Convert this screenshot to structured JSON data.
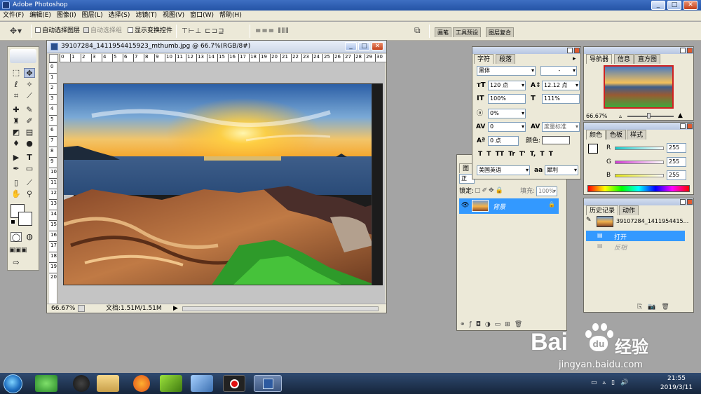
{
  "app": {
    "title": "Adobe Photoshop",
    "window_buttons": [
      "_",
      "□",
      "✕"
    ]
  },
  "menu": [
    "文件(F)",
    "编辑(E)",
    "图像(I)",
    "图层(L)",
    "选择(S)",
    "滤镜(T)",
    "视图(V)",
    "窗口(W)",
    "帮助(H)"
  ],
  "options": {
    "auto_select_layer": "自动选择图层",
    "auto_select_group": "自动选择组",
    "show_transform": "显示变换控件",
    "palette_tabs": [
      "画笔",
      "工具预设",
      "图层复合"
    ]
  },
  "document": {
    "title": "39107284_1411954415923_mthumb.jpg @ 66.7%(RGB/8#)",
    "zoom": "66.67%",
    "file_info": "文档:1.51M/1.51M",
    "ruler_h": [
      "0",
      "1",
      "2",
      "3",
      "4",
      "5",
      "6",
      "7",
      "8",
      "9",
      "10",
      "11",
      "12",
      "13",
      "14",
      "15",
      "16",
      "17",
      "18",
      "19",
      "20",
      "21",
      "22",
      "23",
      "24",
      "25",
      "26",
      "27",
      "28",
      "29",
      "30"
    ],
    "ruler_v": [
      "0",
      "1",
      "2",
      "3",
      "4",
      "5",
      "6",
      "7",
      "8",
      "9",
      "10",
      "11",
      "12",
      "13",
      "14",
      "15",
      "16",
      "17",
      "18",
      "19",
      "20"
    ]
  },
  "character": {
    "tabs": [
      "字符",
      "段落"
    ],
    "font": "黑体",
    "style": "-",
    "size": "120 点",
    "leading": "12.12 点",
    "vscale": "100%",
    "hscale": "111%",
    "baseline_pct": "0%",
    "kerning": "0",
    "tracking": "度量标准",
    "shift": "0 点",
    "color_label": "颜色:",
    "styles_row": [
      "T",
      "T",
      "TT",
      "Tr",
      "T'",
      "T,",
      "T",
      "T"
    ],
    "language": "美国英语",
    "aa_label": "aa",
    "aa": "犀利"
  },
  "layers": {
    "tab": "图",
    "blend": "正",
    "lock_label": "锁定:",
    "fill_label": "填充:",
    "fill": "100%",
    "layer_name": "背景"
  },
  "navigator": {
    "tabs": [
      "导航器",
      "信息",
      "直方图"
    ],
    "zoom": "66.67%"
  },
  "color": {
    "tabs": [
      "颜色",
      "色板",
      "样式"
    ],
    "channels": [
      {
        "label": "R",
        "value": "255",
        "color": "#19c8c8"
      },
      {
        "label": "G",
        "value": "255",
        "color": "#d23cd2"
      },
      {
        "label": "B",
        "value": "255",
        "color": "#e6e614"
      }
    ]
  },
  "history": {
    "tabs": [
      "历史记录",
      "动作"
    ],
    "snapshot": "39107284_1411954415...",
    "items": [
      {
        "label": "打开",
        "selected": true
      },
      {
        "label": "反相",
        "selected": false
      }
    ]
  },
  "taskbar": {
    "time": "21:55",
    "date": "2019/3/11"
  },
  "watermark": {
    "brand": "Bai",
    "paw": "du",
    "jingyan": "经验",
    "url": "jingyan.baidu.com"
  },
  "colors": {
    "selection": "#3399ff",
    "title_blue": "#2453a6"
  }
}
